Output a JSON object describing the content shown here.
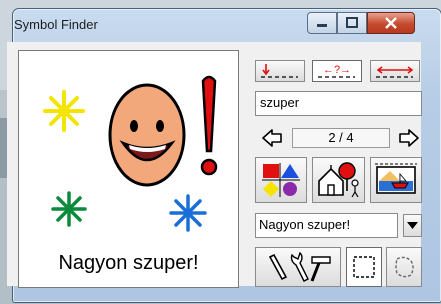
{
  "window": {
    "title": "Symbol Finder"
  },
  "canvas": {
    "caption": "Nagyon szuper!"
  },
  "search": {
    "value": "szuper"
  },
  "navigation": {
    "counter": "2 / 4"
  },
  "meaning_select": {
    "selected": "Nagyon szuper!"
  },
  "mode_buttons": {
    "left": "↓",
    "middle": "↔?↔",
    "right": "⟷"
  },
  "colors": {
    "accent_red": "#e01010",
    "star_yellow": "#f4e400",
    "star_green": "#0a8a3a",
    "star_blue": "#1a6ed8",
    "face": "#f2a87a"
  }
}
